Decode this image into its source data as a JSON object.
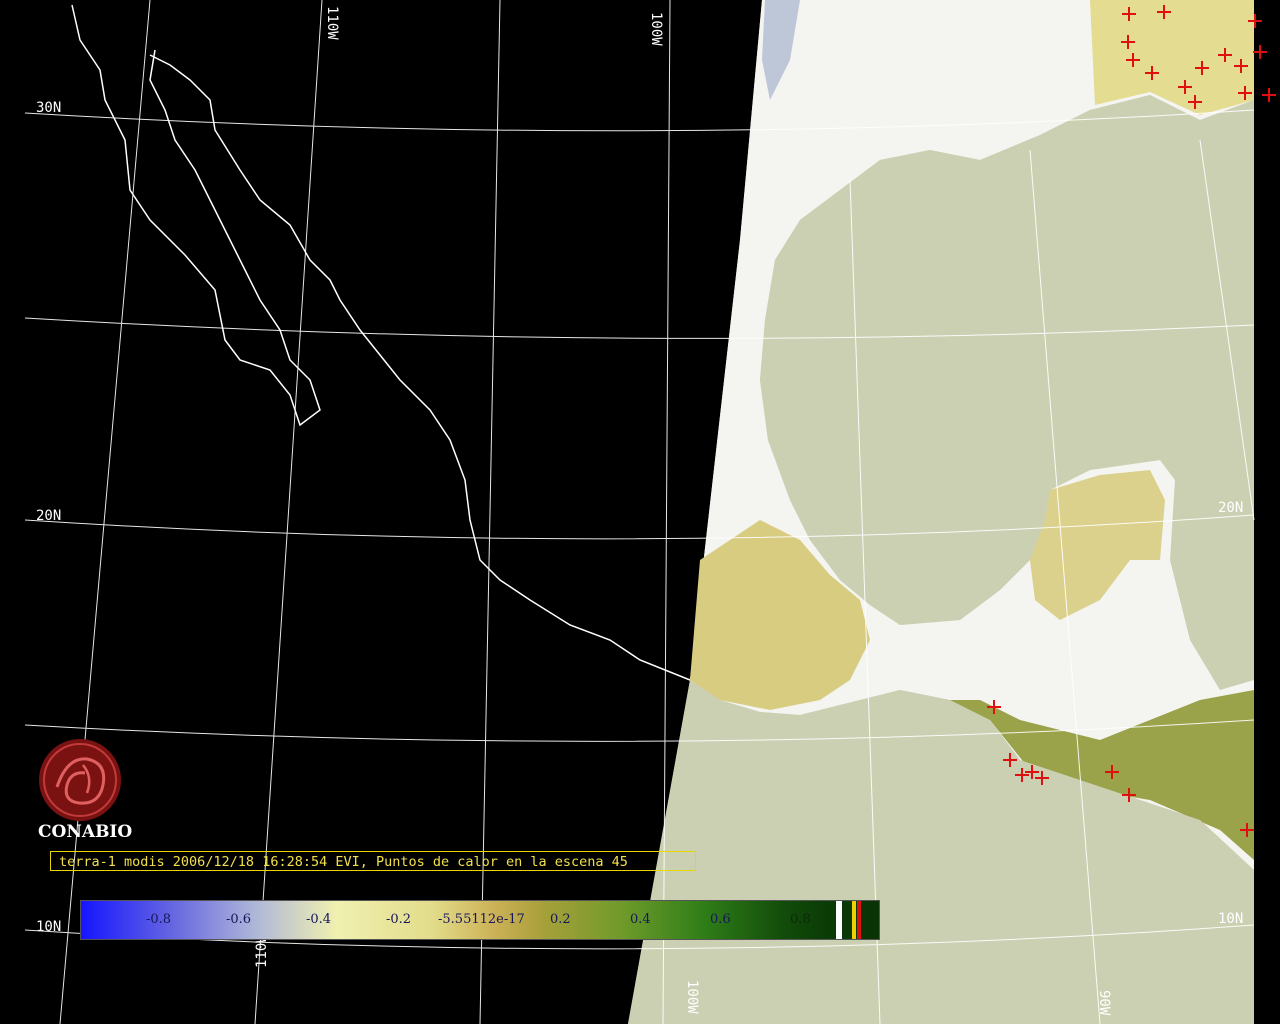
{
  "grid_labels": {
    "lat_30n": "30N",
    "lat_20n_left": "20N",
    "lat_10n_left": "10N",
    "lat_20n_right": "20N",
    "lat_10n_right": "10N",
    "lon_110w_top": "110W",
    "lon_100w_top": "100W",
    "lon_110w_bottom": "110W",
    "lon_100w_bottom": "100W",
    "lon_90w_bottom": "90W"
  },
  "logo": {
    "name": "CONABIO"
  },
  "caption": "terra-1 modis 2006/12/18 16:28:54 EVI, Puntos de calor en la escena 45",
  "colorbar": {
    "labels": [
      "-0.8",
      "-0.6",
      "-0.4",
      "-0.2",
      "-5.55112e-17",
      "0.2",
      "0.4",
      "0.6",
      "0.8"
    ],
    "colors": {
      "negative": "#1515ff",
      "neutral": "#f0f0b0",
      "positive": "#0a3306"
    }
  },
  "colors": {
    "ocean": "#ccd0b2",
    "hotspot": "#e01010",
    "grid": "#ffffff",
    "coastline": "#ffffff"
  }
}
